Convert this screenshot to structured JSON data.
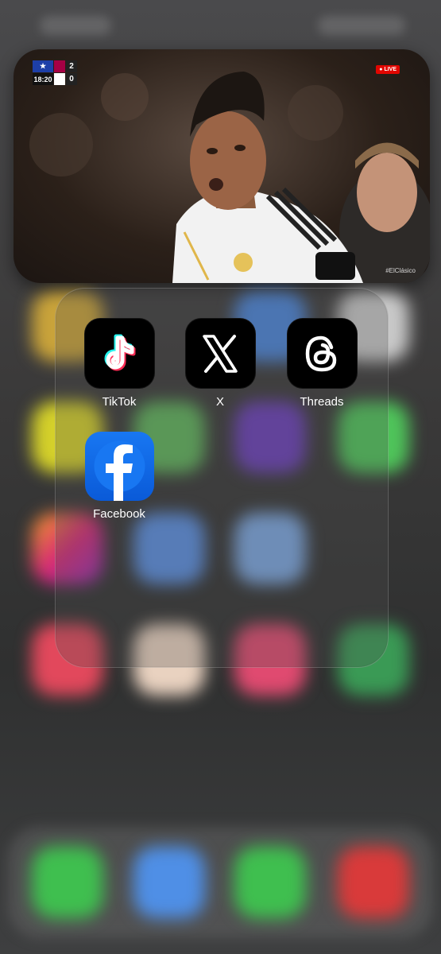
{
  "pip": {
    "scorebug": {
      "time": "18:20",
      "score_home": "2",
      "score_away": "0"
    },
    "live_label": "LIVE",
    "hashtag": "#ElClásico"
  },
  "folder": {
    "apps": [
      {
        "label": "TikTok",
        "icon": "tiktok-icon"
      },
      {
        "label": "X",
        "icon": "x-icon"
      },
      {
        "label": "Threads",
        "icon": "threads-icon"
      },
      {
        "label": "Facebook",
        "icon": "facebook-icon"
      }
    ]
  },
  "colors": {
    "facebook_blue": "#1877f2",
    "live_red": "#e10600",
    "tiktok_cyan": "#25f4ee",
    "tiktok_pink": "#fe2c55"
  }
}
